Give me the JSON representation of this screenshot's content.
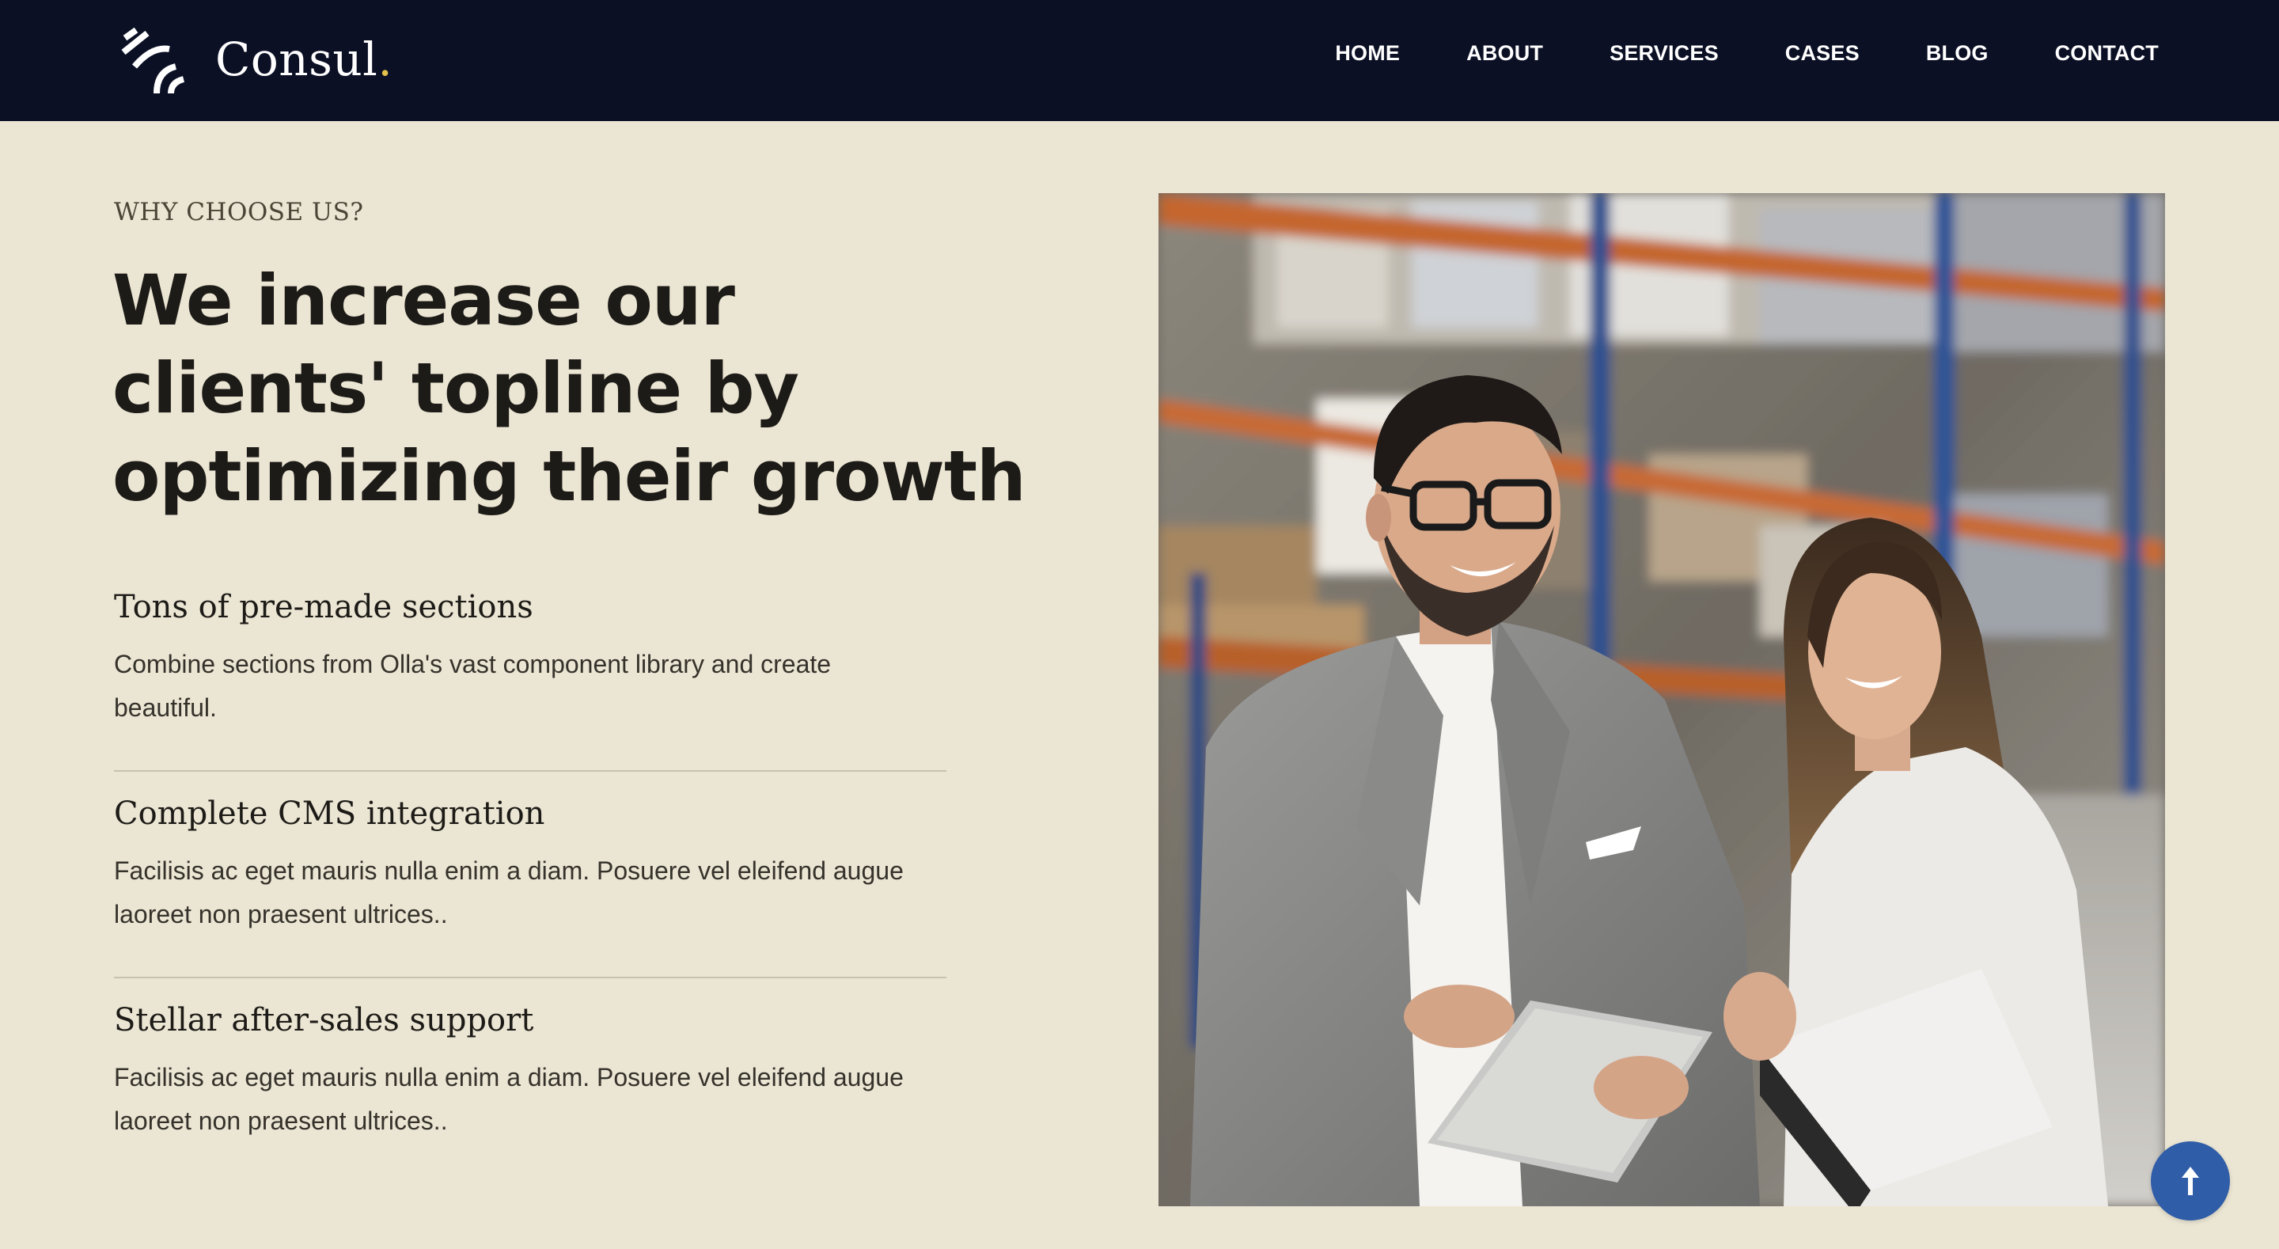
{
  "brand": {
    "name": "Consul",
    "dot": ".",
    "logo_icon": "wave-signal-icon",
    "accent_color": "#e4c14a"
  },
  "nav": {
    "items": [
      {
        "label": "HOME"
      },
      {
        "label": "ABOUT"
      },
      {
        "label": "SERVICES"
      },
      {
        "label": "CASES"
      },
      {
        "label": "BLOG"
      },
      {
        "label": "CONTACT"
      }
    ]
  },
  "section": {
    "eyebrow": "WHY CHOOSE US?",
    "headline": "We increase our clients' topline by optimizing their growth",
    "features": [
      {
        "title": "Tons of pre-made sections",
        "description": "Combine sections from Olla's vast component library and create beautiful."
      },
      {
        "title": "Complete CMS integration",
        "description": "Facilisis ac eget mauris nulla enim a diam. Posuere vel eleifend augue laoreet non praesent ultrices.."
      },
      {
        "title": "Stellar after-sales support",
        "description": "Facilisis ac eget mauris nulla enim a diam. Posuere vel eleifend augue laoreet non praesent ultrices.."
      }
    ]
  },
  "photo": {
    "icon": "warehouse-business-people-photo"
  },
  "back_to_top": {
    "icon": "arrow-up-icon",
    "color": "#2f5da8"
  },
  "colors": {
    "header_bg": "#0b1025",
    "page_bg": "#ebe5d3"
  }
}
